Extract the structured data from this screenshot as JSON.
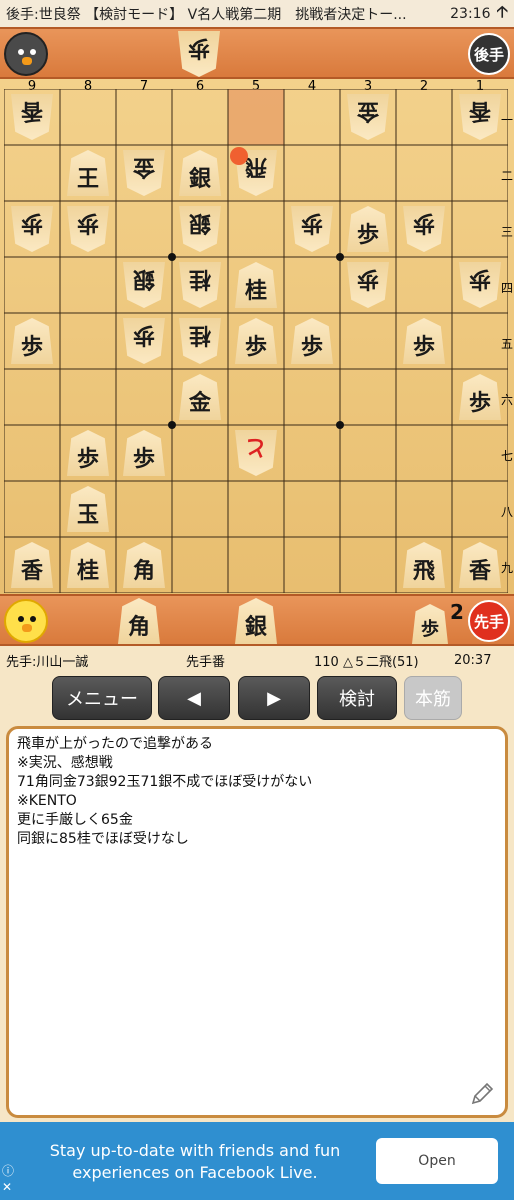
{
  "status_bar": {
    "title": "後手:世良祭 【検討モード】 V名人戦第二期　挑戦者決定トー...",
    "time": "23:16",
    "arrow": "🡡"
  },
  "gote_stand": {
    "side_label": "後手",
    "pieces": [
      {
        "label": "歩",
        "count": ""
      }
    ]
  },
  "sente_stand": {
    "side_label": "先手",
    "pieces": [
      {
        "label": "角",
        "count": ""
      },
      {
        "label": "銀",
        "count": ""
      },
      {
        "label": "歩",
        "count": "2"
      }
    ]
  },
  "board": {
    "file_labels": [
      "9",
      "8",
      "7",
      "6",
      "5",
      "4",
      "3",
      "2",
      "1"
    ],
    "rank_labels": [
      "一",
      "二",
      "三",
      "四",
      "五",
      "六",
      "七",
      "八",
      "九"
    ],
    "last_move_square": {
      "file": 5,
      "rank": 1
    },
    "pieces": [
      {
        "file": 9,
        "rank": 1,
        "label": "香",
        "owner": "gote"
      },
      {
        "file": 3,
        "rank": 1,
        "label": "金",
        "owner": "gote"
      },
      {
        "file": 1,
        "rank": 1,
        "label": "香",
        "owner": "gote"
      },
      {
        "file": 8,
        "rank": 2,
        "label": "王",
        "owner": "sente"
      },
      {
        "file": 7,
        "rank": 2,
        "label": "金",
        "owner": "gote"
      },
      {
        "file": 6,
        "rank": 2,
        "label": "銀",
        "owner": "sente"
      },
      {
        "file": 5,
        "rank": 2,
        "label": "飛",
        "owner": "gote"
      },
      {
        "file": 9,
        "rank": 3,
        "label": "歩",
        "owner": "gote"
      },
      {
        "file": 8,
        "rank": 3,
        "label": "歩",
        "owner": "gote"
      },
      {
        "file": 6,
        "rank": 3,
        "label": "銀",
        "owner": "gote"
      },
      {
        "file": 4,
        "rank": 3,
        "label": "歩",
        "owner": "gote"
      },
      {
        "file": 3,
        "rank": 3,
        "label": "歩",
        "owner": "sente"
      },
      {
        "file": 2,
        "rank": 3,
        "label": "歩",
        "owner": "gote"
      },
      {
        "file": 7,
        "rank": 4,
        "label": "銀",
        "owner": "gote"
      },
      {
        "file": 6,
        "rank": 4,
        "label": "桂",
        "owner": "gote"
      },
      {
        "file": 5,
        "rank": 4,
        "label": "桂",
        "owner": "sente"
      },
      {
        "file": 3,
        "rank": 4,
        "label": "歩",
        "owner": "gote"
      },
      {
        "file": 1,
        "rank": 4,
        "label": "歩",
        "owner": "gote"
      },
      {
        "file": 9,
        "rank": 5,
        "label": "歩",
        "owner": "sente"
      },
      {
        "file": 7,
        "rank": 5,
        "label": "歩",
        "owner": "gote"
      },
      {
        "file": 6,
        "rank": 5,
        "label": "桂",
        "owner": "gote"
      },
      {
        "file": 5,
        "rank": 5,
        "label": "歩",
        "owner": "sente"
      },
      {
        "file": 4,
        "rank": 5,
        "label": "歩",
        "owner": "sente"
      },
      {
        "file": 2,
        "rank": 5,
        "label": "歩",
        "owner": "sente"
      },
      {
        "file": 6,
        "rank": 6,
        "label": "金",
        "owner": "sente"
      },
      {
        "file": 1,
        "rank": 6,
        "label": "歩",
        "owner": "sente"
      },
      {
        "file": 8,
        "rank": 7,
        "label": "歩",
        "owner": "sente"
      },
      {
        "file": 7,
        "rank": 7,
        "label": "歩",
        "owner": "sente"
      },
      {
        "file": 5,
        "rank": 7,
        "label": "と",
        "owner": "gote",
        "promoted": true
      },
      {
        "file": 8,
        "rank": 8,
        "label": "玉",
        "owner": "sente"
      },
      {
        "file": 9,
        "rank": 9,
        "label": "香",
        "owner": "sente"
      },
      {
        "file": 8,
        "rank": 9,
        "label": "桂",
        "owner": "sente"
      },
      {
        "file": 7,
        "rank": 9,
        "label": "角",
        "owner": "sente"
      },
      {
        "file": 2,
        "rank": 9,
        "label": "飛",
        "owner": "sente"
      },
      {
        "file": 1,
        "rank": 9,
        "label": "香",
        "owner": "sente"
      }
    ]
  },
  "info_bar": {
    "sente_player": "先手:川山一誠",
    "turn": "先手番",
    "move": "110 △５二飛(51)",
    "clock": "20:37"
  },
  "buttons": {
    "menu": "メニュー",
    "prev": "◀",
    "next": "▶",
    "analyze": "検討",
    "mainline": "本筋"
  },
  "notes": [
    "飛車が上がったので追撃がある",
    "※実況、感想戦",
    "71角同金73銀92玉71銀不成でほぼ受けがない",
    "※KENTO",
    "更に手厳しく65金",
    "同銀に85桂でほぼ受けなし"
  ],
  "ad": {
    "text": "Stay up-to-date with friends and fun experiences on Facebook Live.",
    "cta": "Open",
    "info_icon": "ⓘ",
    "close_icon": "✕"
  },
  "colors": {
    "stand": "#d97a3c",
    "board": "#eec57c",
    "highlight": "#e9a36a",
    "last_move_dot": "#f06030",
    "sente_badge": "#e0301e",
    "gote_badge": "#333333",
    "ad_bg": "#2f8fd0"
  }
}
